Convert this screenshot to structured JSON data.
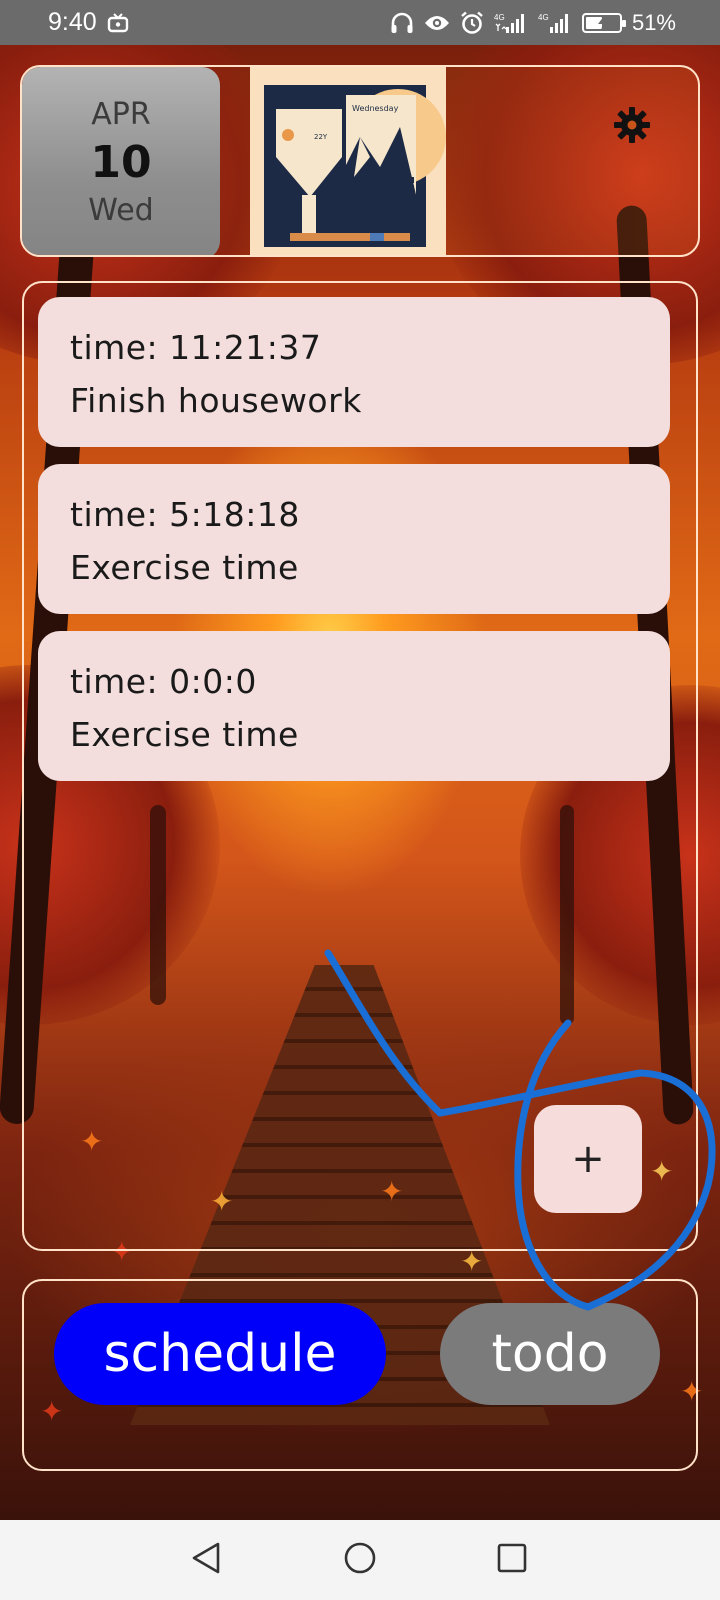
{
  "status_bar": {
    "time": "9:40",
    "battery": "51%",
    "battery_level": 0.51,
    "icons": [
      "tv-icon",
      "headphones-icon",
      "eye-icon",
      "alarm-icon",
      "signal-4g-icon",
      "signal-4g-icon",
      "battery-charging-icon"
    ],
    "signal_label_1": "4G",
    "signal_label_2": "4G"
  },
  "header": {
    "month": "APR",
    "day": "10",
    "weekday": "Wed",
    "calendar_art_label": "Wednesday",
    "calendar_art_year": "22Y",
    "settings_icon": "gear-icon"
  },
  "tasks": [
    {
      "time": "time: 11:21:37",
      "name": "Finish housework"
    },
    {
      "time": "time: 5:18:18",
      "name": "Exercise time"
    },
    {
      "time": "time: 0:0:0",
      "name": "Exercise time"
    }
  ],
  "add_button": {
    "label": "+"
  },
  "tabs": {
    "schedule_label": "schedule",
    "todo_label": "todo",
    "active": "schedule",
    "active_color": "#0000fa",
    "inactive_color": "#7b7b7b"
  },
  "nav": {
    "icons": [
      "back-icon",
      "home-icon",
      "recents-icon"
    ]
  },
  "colors": {
    "card_background": "#f3dedd",
    "scribble": "#1a6fd6"
  }
}
